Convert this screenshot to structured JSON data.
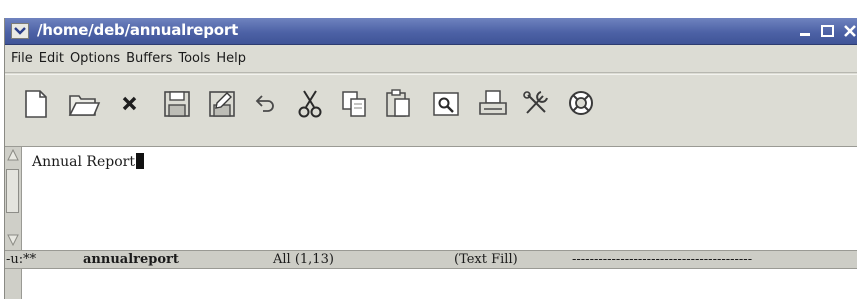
{
  "window": {
    "title": "/home/deb/annualreport"
  },
  "menubar": {
    "items": [
      {
        "label": "File"
      },
      {
        "label": "Edit"
      },
      {
        "label": "Options"
      },
      {
        "label": "Buffers"
      },
      {
        "label": "Tools"
      },
      {
        "label": "Help"
      }
    ]
  },
  "toolbar": {
    "buttons": [
      {
        "icon": "new-file-icon"
      },
      {
        "icon": "open-folder-icon"
      },
      {
        "icon": "close-x-icon"
      },
      {
        "icon": "save-icon"
      },
      {
        "icon": "save-as-icon"
      },
      {
        "icon": "undo-icon"
      },
      {
        "icon": "cut-icon"
      },
      {
        "icon": "copy-icon"
      },
      {
        "icon": "paste-icon"
      },
      {
        "icon": "search-icon"
      },
      {
        "icon": "print-icon"
      },
      {
        "icon": "tools-icon"
      },
      {
        "icon": "help-lifebuoy-icon"
      }
    ]
  },
  "buffer": {
    "text": "Annual Report"
  },
  "modeline": {
    "status": "-u:**",
    "buffer_name": "annualreport",
    "position": "All (1,13)",
    "mode": "(Text Fill)",
    "fill": "-----------------------------------------"
  },
  "colors": {
    "titlebar": "#4d62a6",
    "chrome": "#dcdcd4",
    "editor_bg": "#ffffff"
  }
}
